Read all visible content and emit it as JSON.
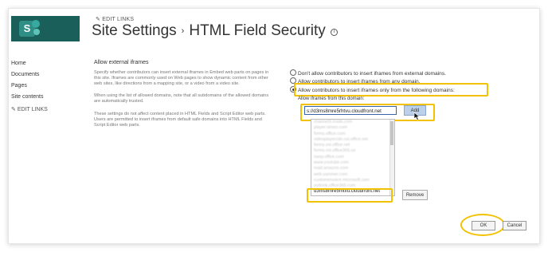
{
  "header": {
    "edit_links": "EDIT LINKS",
    "breadcrumb_root": "Site Settings",
    "breadcrumb_sep": "›",
    "page_title": "HTML Field Security",
    "info_glyph": "i"
  },
  "nav": {
    "items": [
      "Home",
      "Documents",
      "Pages",
      "Site contents"
    ],
    "edit_links": "EDIT LINKS"
  },
  "section": {
    "title": "Allow external iframes",
    "para1": "Specify whether contributors can insert external iframes in Embed web parts on pages in this site. Iframes are commonly used on Web pages to show dynamic content from other web sites, like directions from a mapping site, or a video from a video site.",
    "para2": "When using the list of allowed domains, note that all subdomains of the allowed domains are automatically trusted.",
    "para3": "These settings do not affect content placed in HTML Fields and Script Editor web parts. Users are permitted to insert iframes from default safe domains into HTML Fields and Script Editor web parts."
  },
  "options": {
    "opt1": "Don't allow contributors to insert iframes from external domains.",
    "opt2": "Allow contributors to insert iframes from any domain.",
    "opt3": "Allow contributors to insert iframes only from the following domains:",
    "selected": "opt3"
  },
  "domains": {
    "label": "Allow iframes from this domain:",
    "input_value": "s://d3ms8mre5rhtvu.cloudfront.net",
    "add_label": "Add",
    "list_items": [
      "channel9.msdn.com",
      "player.vimeo.com",
      "forms.office.com",
      "videoplayercdn.osi.office.net",
      "forms.osi.office.net",
      "forms.osi.office365.us",
      "sway.office.com",
      "www.youtube.com",
      "read.amazon.com",
      "web.yammer.com",
      "customervoice.microsoft.com",
      "outlook.office365.com"
    ],
    "selected_item": "d3ms8mre5rhtvu.cloudfront.net",
    "remove_label": "Remove"
  },
  "footer": {
    "ok_label": "OK",
    "cancel_label": "Cancel"
  },
  "colors": {
    "highlight": "#f2c200",
    "logo_bg": "#1b5f5a",
    "add_button": "#bcd0ea"
  }
}
